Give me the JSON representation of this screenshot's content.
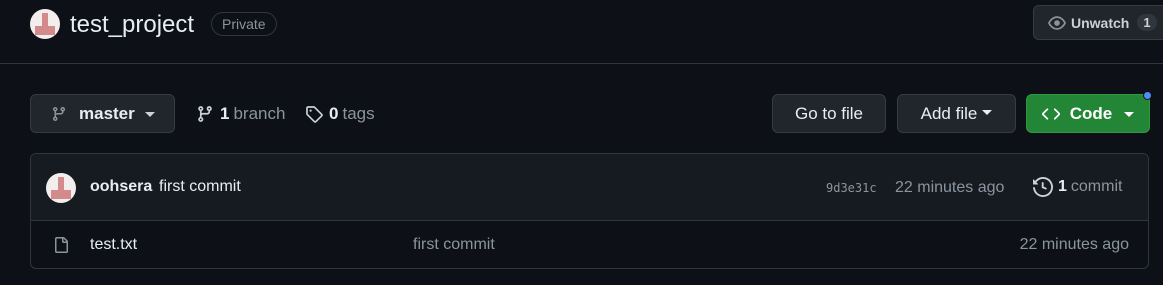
{
  "repo": {
    "name": "test_project",
    "visibility": "Private"
  },
  "watch": {
    "label": "Unwatch",
    "count": "1"
  },
  "toolbar": {
    "branch_label": "master",
    "branches_count": "1",
    "branches_label": "branch",
    "tags_count": "0",
    "tags_label": "tags",
    "goto_file": "Go to file",
    "add_file": "Add file",
    "code": "Code"
  },
  "latest_commit": {
    "author": "oohsera",
    "message": "first commit",
    "sha": "9d3e31c",
    "time": "22 minutes ago",
    "commits_count": "1",
    "commits_label": "commit"
  },
  "files": [
    {
      "name": "test.txt",
      "commit_message": "first commit",
      "time": "22 minutes ago",
      "icon": "file-icon"
    }
  ],
  "colors": {
    "background": "#0d1117",
    "code_button": "#238636",
    "notification_dot": "#4f8cf7",
    "avatar": "#d48a8a"
  }
}
